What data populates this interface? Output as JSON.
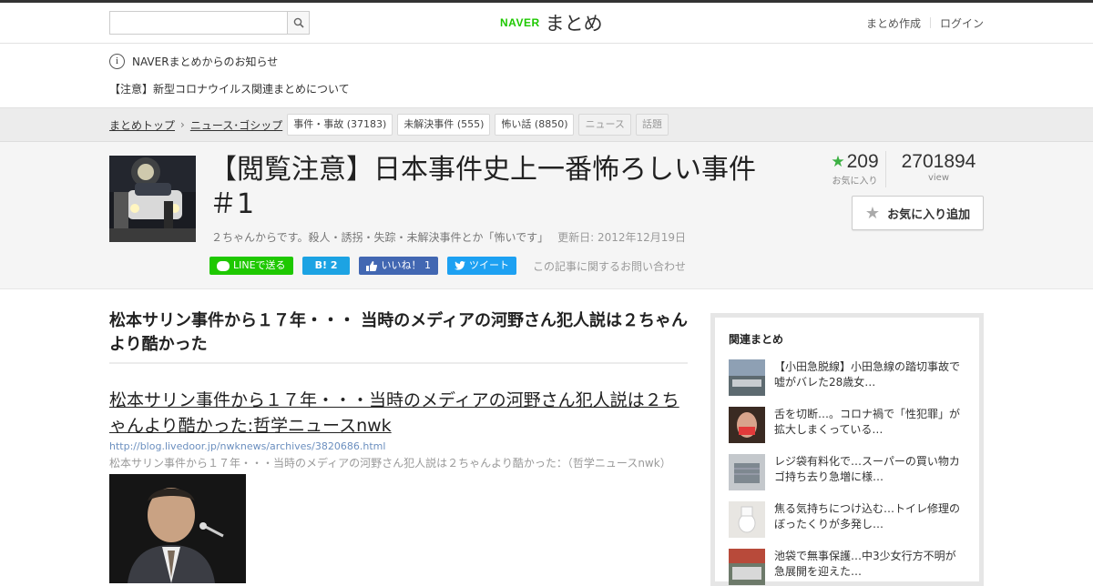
{
  "header": {
    "search_placeholder": "",
    "logo_brand": "NAVER",
    "logo_service": "まとめ",
    "links": [
      "まとめ作成",
      "ログイン"
    ]
  },
  "notice": {
    "title": "NAVERまとめからのお知らせ",
    "item": "【注意】新型コロナウイルス関連まとめについて"
  },
  "breadcrumb": {
    "top": "まとめトップ",
    "category": "ニュース･ゴシップ",
    "tags": [
      {
        "label": "事件・事故",
        "count": "(37183)"
      },
      {
        "label": "未解決事件",
        "count": "(555)"
      },
      {
        "label": "怖い話",
        "count": "(8850)"
      },
      {
        "label": "ニュース",
        "count": ""
      },
      {
        "label": "話題",
        "count": ""
      }
    ]
  },
  "article": {
    "title": "【閲覧注意】日本事件史上一番怖ろしい事件＃1",
    "description": "２ちゃんからです。殺人・誘拐・失踪・未解決事件とか「怖いです」",
    "updated": "更新日: 2012年12月19日",
    "share": {
      "line": "LINEで送る",
      "hatena_icon": "B!",
      "hatena_count": "2",
      "fb_label": "いいね！",
      "fb_count": "1",
      "tweet": "ツイート",
      "contact": "この記事に関するお問い合わせ"
    },
    "favorites": "209",
    "favorites_label": "お気に入り",
    "views": "2701894",
    "views_label": "view",
    "fav_button": "お気に入り追加"
  },
  "content": {
    "heading": "松本サリン事件から１７年・・・ 当時のメディアの河野さん犯人説は２ちゃんより酷かった",
    "link_title": "松本サリン事件から１７年・・・当時のメディアの河野さん犯人説は２ちゃんより酷かった:哲学ニュースnwk",
    "link_url": "http://blog.livedoor.jp/nwknews/archives/3820686.html",
    "link_desc": "松本サリン事件から１７年・・・当時のメディアの河野さん犯人説は２ちゃんより酷かった：（哲学ニュースnwk）"
  },
  "sidebar": {
    "title": "関連まとめ",
    "items": [
      {
        "text": "【小田急脱線】小田急線の踏切事故で嘘がバレた28歳女…"
      },
      {
        "text": "舌を切断…。コロナ禍で「性犯罪」が拡大しまくっている…"
      },
      {
        "text": "レジ袋有料化で…スーパーの買い物カゴ持ち去り急増に様…"
      },
      {
        "text": "焦る気持ちにつけ込む…トイレ修理のぼったくりが多発し…"
      },
      {
        "text": "池袋で無事保護…中3少女行方不明が急展開を迎えた…"
      }
    ]
  },
  "colors": {
    "line": "#1ec800",
    "hatena": "#1ca3e3",
    "facebook": "#4267b2",
    "twitter": "#1da1f2",
    "star": "#3cb043"
  }
}
